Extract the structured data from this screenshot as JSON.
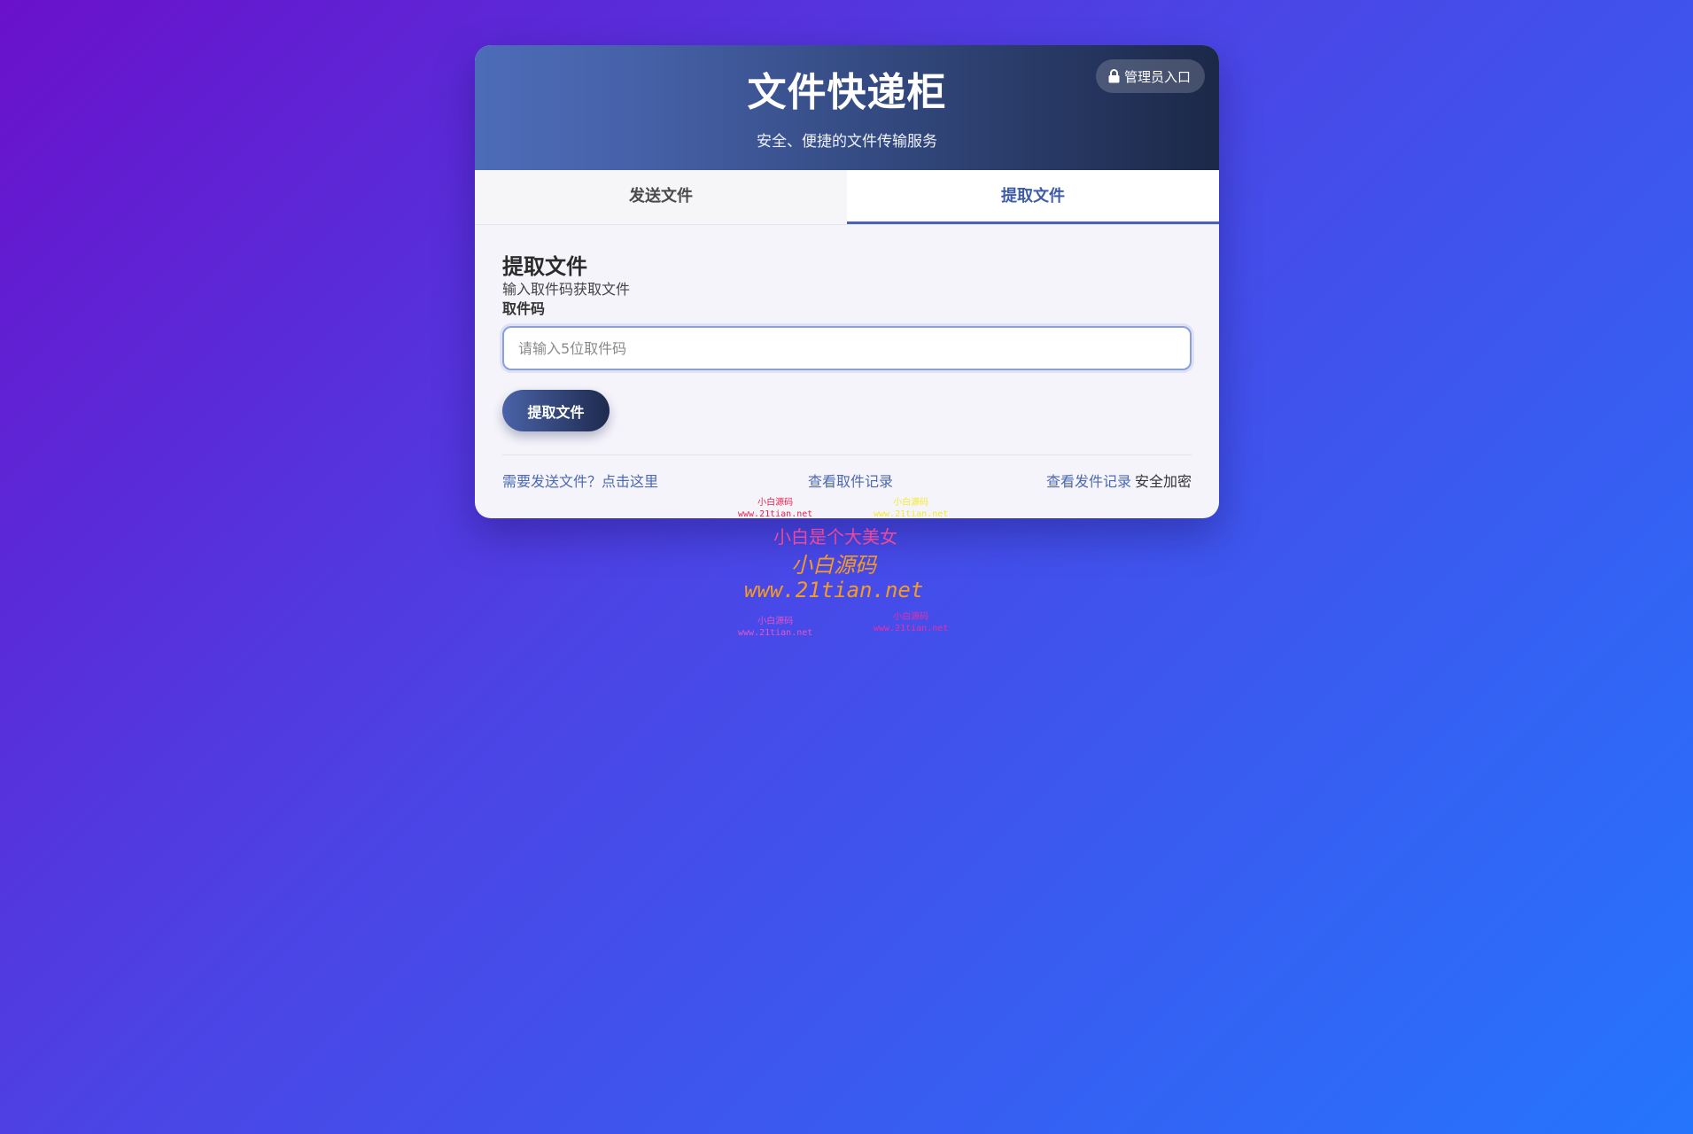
{
  "header": {
    "title": "文件快递柜",
    "subtitle": "安全、便捷的文件传输服务",
    "admin_label": "管理员入口"
  },
  "tabs": [
    {
      "label": "发送文件",
      "active": false
    },
    {
      "label": "提取文件",
      "active": true
    }
  ],
  "pickup": {
    "title": "提取文件",
    "description": "输入取件码获取文件",
    "field_label": "取件码",
    "input_value": "",
    "input_placeholder": "请输入5位取件码",
    "submit_label": "提取文件"
  },
  "footer": {
    "send_link": "需要发送文件？点击这里",
    "pickup_log_link": "查看取件记录",
    "send_log_link": "查看发件记录",
    "secure_text": "安全加密"
  },
  "watermarks": {
    "red_line1": "小白源码",
    "red_line2": "www.21tian.net",
    "yellow_line1": "小白源码",
    "yellow_line2": "www.21tian.net",
    "main": "小白是个大美女",
    "orange_line1": "小白源码",
    "orange_line2": "www.21tian.net",
    "pink_line1": "小白源码",
    "pink_line2": "www.21tian.net",
    "magenta_line1": "小白源码",
    "magenta_line2": "www.21tian.net"
  },
  "colors": {
    "accent": "#4a63b0",
    "header_start": "#4d6cb8",
    "header_end": "#1c2848",
    "link": "#4d69b0"
  }
}
